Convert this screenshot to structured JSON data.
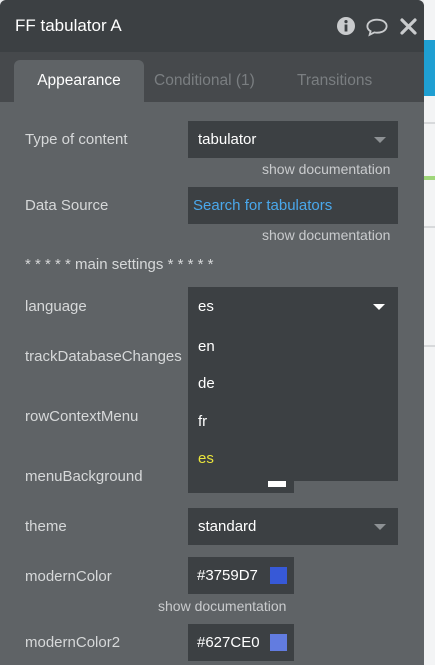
{
  "window": {
    "title": "FF tabulator A"
  },
  "tabs": [
    {
      "label": "Appearance",
      "active": true
    },
    {
      "label": "Conditional (1)",
      "active": false
    },
    {
      "label": "Transitions",
      "active": false
    }
  ],
  "fields": {
    "type_of_content": {
      "label": "Type of content",
      "value": "tabulator",
      "doc": "show documentation"
    },
    "data_source": {
      "label": "Data Source",
      "placeholder": "Search for tabulators",
      "doc": "show documentation"
    },
    "section_title": "* * * * * main settings * * * * *",
    "language": {
      "label": "language",
      "value": "es",
      "options": [
        "en",
        "de",
        "fr",
        "es"
      ],
      "selected": "es"
    },
    "track_db_changes": {
      "label": "trackDatabaseChanges"
    },
    "row_context_menu": {
      "label": "rowContextMenu"
    },
    "menu_background": {
      "label": "menuBackground"
    },
    "theme": {
      "label": "theme",
      "value": "standard"
    },
    "modern_color": {
      "label": "modernColor",
      "value": "#3759D7",
      "swatch": "#3759D7",
      "doc": "show documentation"
    },
    "modern_color2": {
      "label": "modernColor2",
      "value": "#627CE0",
      "swatch": "#627CE0"
    }
  },
  "colors": {
    "panel": "#5f6366",
    "header": "#3c4043",
    "field": "#3c4043",
    "link": "#4aa8ec",
    "selected_option": "#e9e43b"
  },
  "icons": [
    "info-icon",
    "comment-icon",
    "close-icon",
    "chevron-down-icon"
  ]
}
